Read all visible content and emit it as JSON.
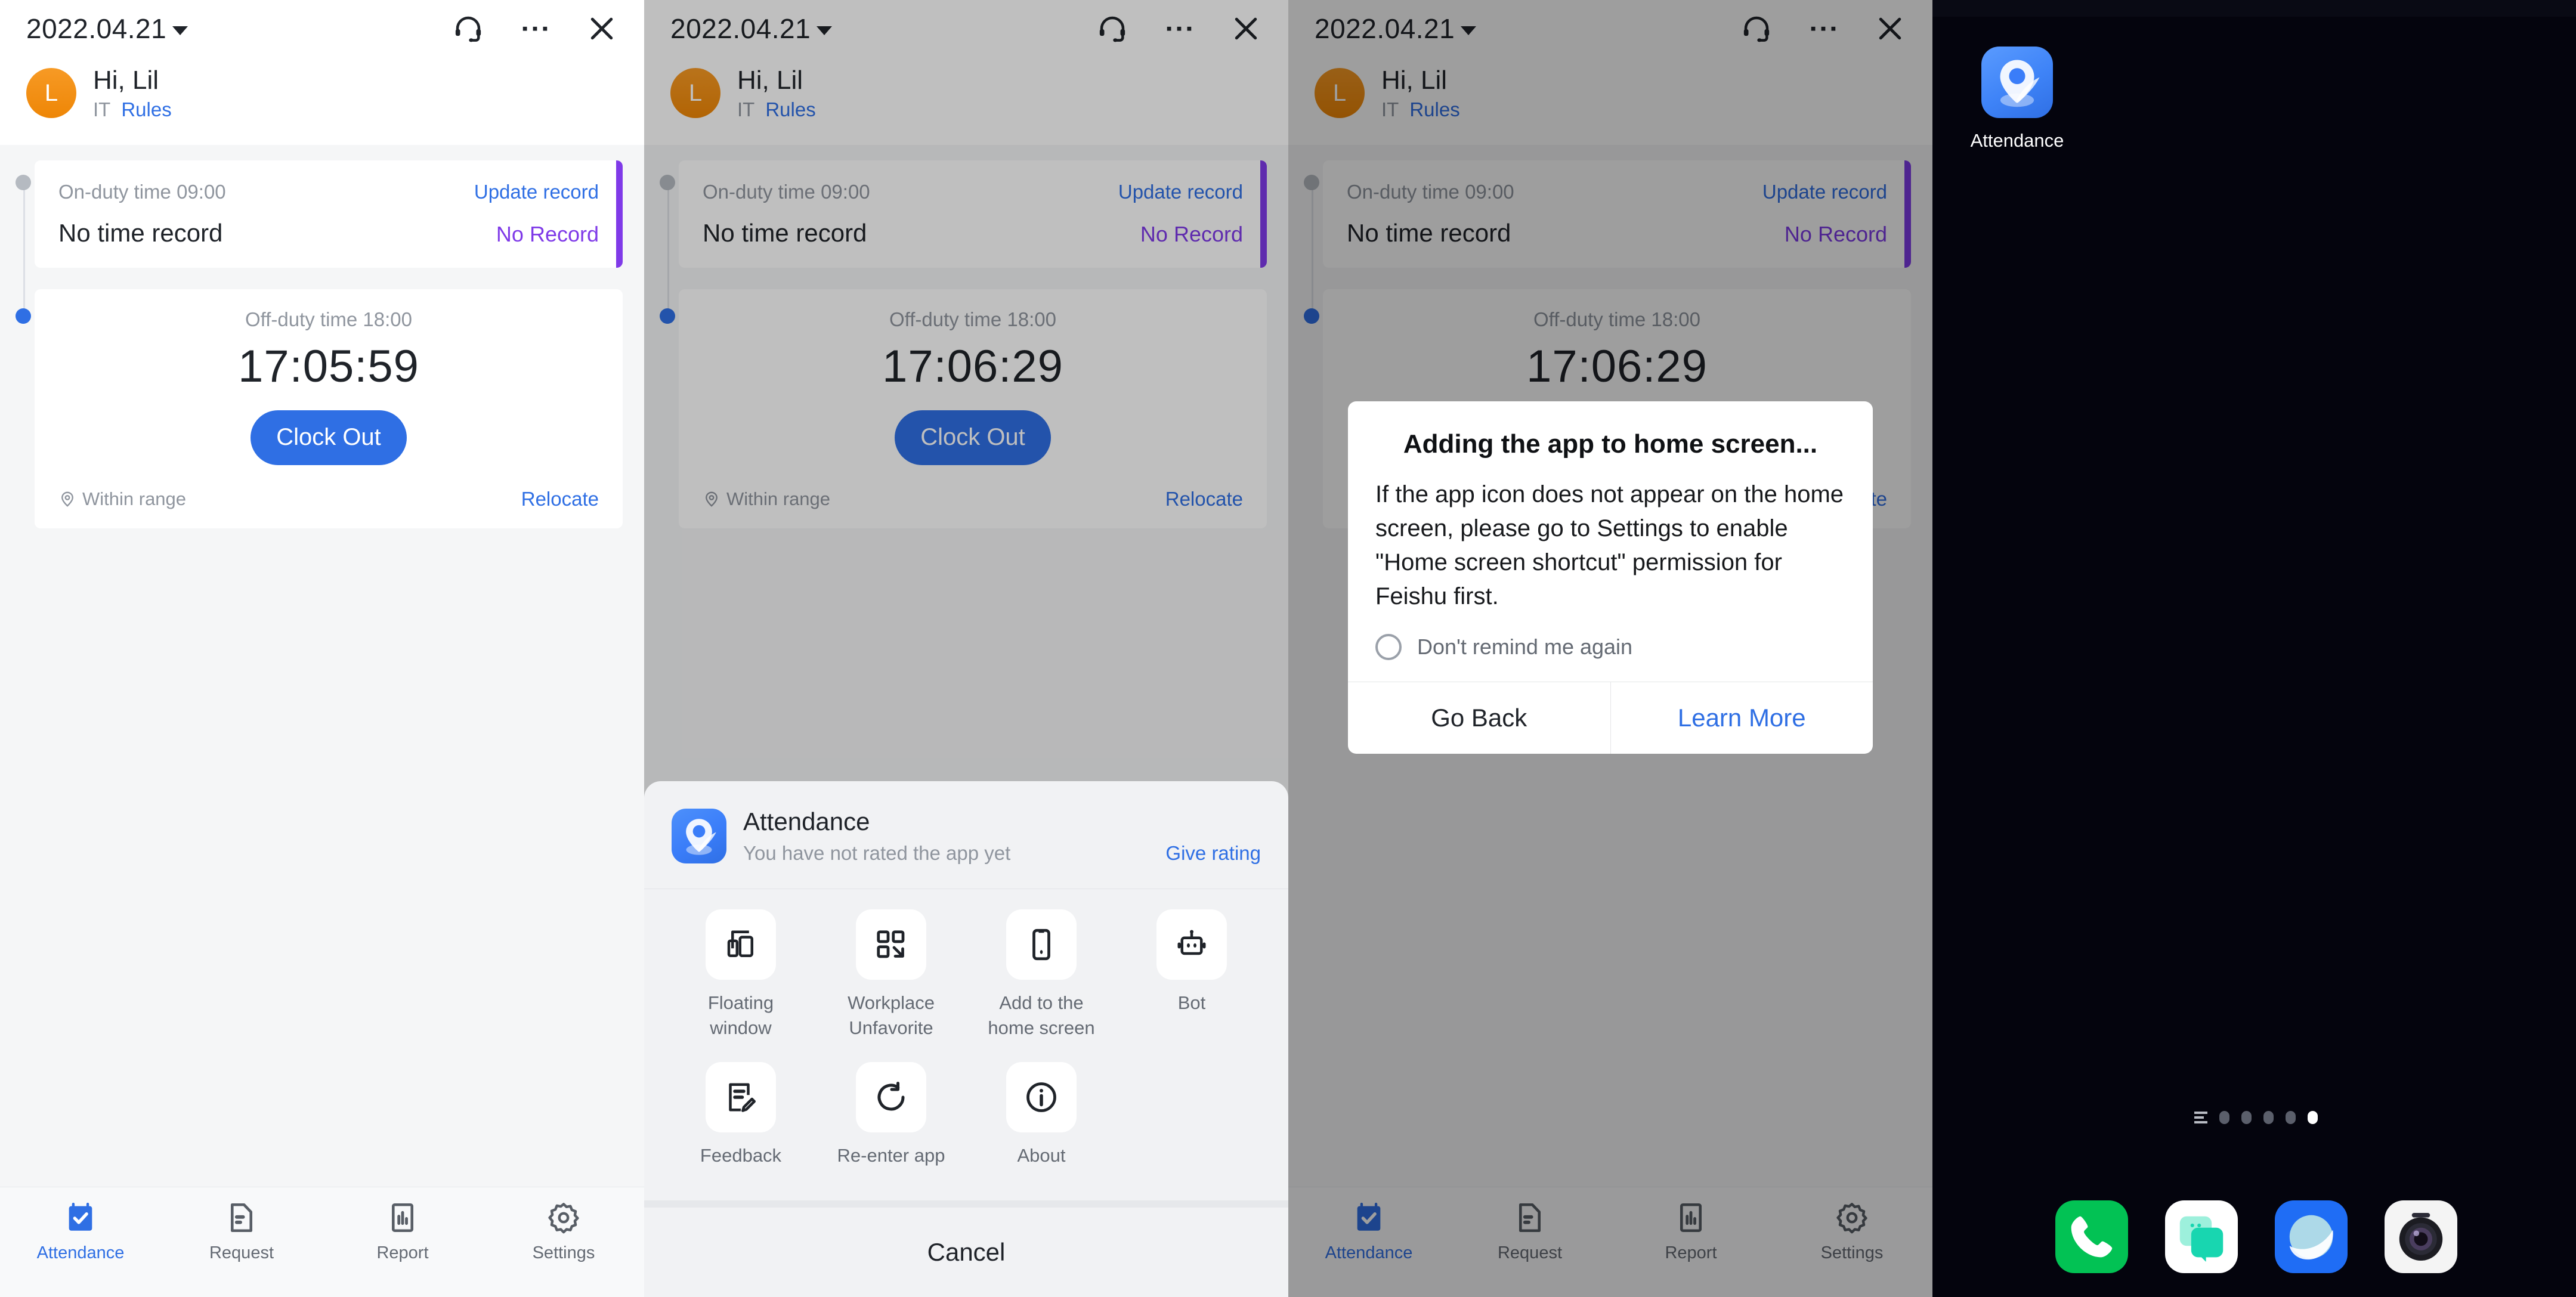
{
  "app": {
    "date": "2022.04.21",
    "icons": {
      "support": "headset-icon",
      "more": "ellipsis-icon",
      "close": "close-icon"
    },
    "user": {
      "avatar_letter": "L",
      "greeting": "Hi, Lil",
      "department": "IT",
      "rules_link": "Rules"
    }
  },
  "attendance": {
    "on_duty_label": "On-duty time 09:00",
    "update_record_link": "Update record",
    "no_time_record": "No time record",
    "no_record_status": "No Record",
    "off_duty_label": "Off-duty time 18:00",
    "timer_p1": "17:05:59",
    "timer_p2": "17:06:29",
    "clock_out_button": "Clock Out",
    "within_range": "Within range",
    "relocate_link": "Relocate",
    "accent_blue": "#2f6fe4",
    "accent_purple": "#7f3ae8"
  },
  "tabs": [
    {
      "label": "Attendance",
      "icon": "calendar-check-icon",
      "active": true
    },
    {
      "label": "Request",
      "icon": "document-icon",
      "active": false
    },
    {
      "label": "Report",
      "icon": "bar-chart-icon",
      "active": false
    },
    {
      "label": "Settings",
      "icon": "gear-icon",
      "active": false
    }
  ],
  "action_sheet": {
    "app_name": "Attendance",
    "app_subtitle": "You have not rated the app yet",
    "rating_link": "Give rating",
    "items": [
      {
        "label": "Floating window",
        "icon": "floating-window-icon"
      },
      {
        "label": "Workplace Unfavorite",
        "icon": "workplace-unfavorite-icon"
      },
      {
        "label": "Add to the home screen",
        "icon": "add-to-home-screen-icon"
      },
      {
        "label": "Bot",
        "icon": "bot-icon"
      },
      {
        "label": "Feedback",
        "icon": "feedback-icon"
      },
      {
        "label": "Re-enter app",
        "icon": "reload-icon"
      },
      {
        "label": "About",
        "icon": "info-icon"
      }
    ],
    "cancel_label": "Cancel"
  },
  "dialog": {
    "title": "Adding the app to home screen...",
    "message": "If the app icon does not appear on the home screen, please go to Settings to enable \"Home screen shortcut\" permission for Feishu first.",
    "checkbox_label": "Don't remind me again",
    "go_back": "Go Back",
    "learn_more": "Learn More"
  },
  "home_screen": {
    "app_label": "Attendance",
    "page_count": 5,
    "active_page": 5,
    "dock": [
      {
        "name": "Phone",
        "icon": "phone-icon"
      },
      {
        "name": "Messages",
        "icon": "messages-icon"
      },
      {
        "name": "Browser",
        "icon": "browser-icon"
      },
      {
        "name": "Camera",
        "icon": "camera-icon"
      }
    ]
  }
}
